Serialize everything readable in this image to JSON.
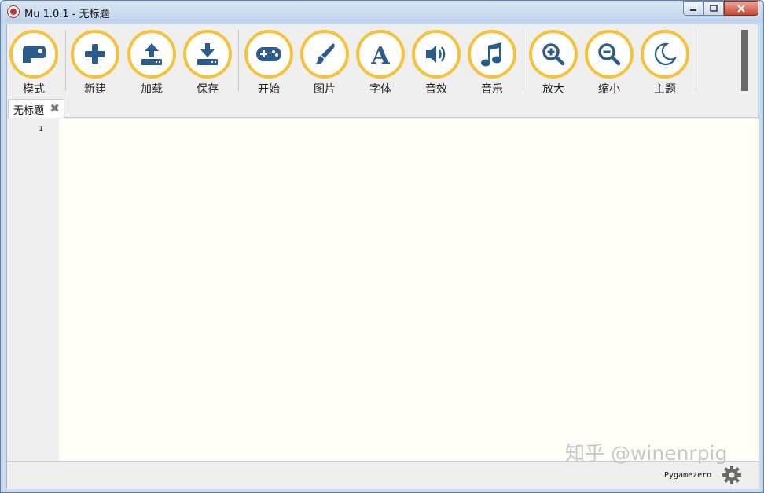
{
  "window": {
    "title": "Mu 1.0.1 - 无标题"
  },
  "toolbar": {
    "buttons": [
      {
        "label": "模式",
        "icon": "mode-icon"
      },
      {
        "label": "新建",
        "icon": "plus-icon"
      },
      {
        "label": "加载",
        "icon": "upload-icon"
      },
      {
        "label": "保存",
        "icon": "download-icon"
      },
      {
        "label": "开始",
        "icon": "gamepad-icon"
      },
      {
        "label": "图片",
        "icon": "paintbrush-icon"
      },
      {
        "label": "字体",
        "icon": "font-icon"
      },
      {
        "label": "音效",
        "icon": "speaker-icon"
      },
      {
        "label": "音乐",
        "icon": "music-note-icon"
      },
      {
        "label": "放大",
        "icon": "zoom-in-icon"
      },
      {
        "label": "缩小",
        "icon": "zoom-out-icon"
      },
      {
        "label": "主题",
        "icon": "moon-icon"
      }
    ]
  },
  "tabs": [
    {
      "label": "无标题",
      "close_glyph": "✖"
    }
  ],
  "editor": {
    "line_numbers": [
      "1"
    ]
  },
  "status": {
    "mode": "Pygamezero"
  },
  "watermark": "知乎 @winenrpig",
  "colors": {
    "accent": "#f5c33b",
    "icon_blue": "#2d5c8a",
    "editor_bg": "#fefef7"
  }
}
